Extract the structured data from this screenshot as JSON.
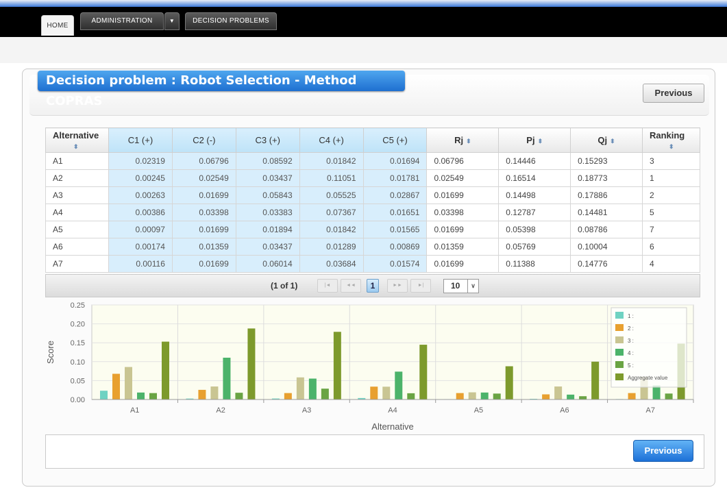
{
  "nav": {
    "home": "HOME",
    "administration": "ADMINISTRATION",
    "admin_arrow": "▼",
    "decision_problems": "DECISION PROBLEMS"
  },
  "page": {
    "title": "Decision problem : Robot Selection - Method COPRAS",
    "previous_top": "Previous",
    "previous_bottom": "Previous"
  },
  "table": {
    "headers": [
      "Alternative",
      "C1 (+)",
      "C2 (-)",
      "C3 (+)",
      "C4 (+)",
      "C5 (+)",
      "Rj",
      "Pj",
      "Qj",
      "Ranking"
    ],
    "rows": [
      [
        "A1",
        "0.02319",
        "0.06796",
        "0.08592",
        "0.01842",
        "0.01694",
        "0.06796",
        "0.14446",
        "0.15293",
        "3"
      ],
      [
        "A2",
        "0.00245",
        "0.02549",
        "0.03437",
        "0.11051",
        "0.01781",
        "0.02549",
        "0.16514",
        "0.18773",
        "1"
      ],
      [
        "A3",
        "0.00263",
        "0.01699",
        "0.05843",
        "0.05525",
        "0.02867",
        "0.01699",
        "0.14498",
        "0.17886",
        "2"
      ],
      [
        "A4",
        "0.00386",
        "0.03398",
        "0.03383",
        "0.07367",
        "0.01651",
        "0.03398",
        "0.12787",
        "0.14481",
        "5"
      ],
      [
        "A5",
        "0.00097",
        "0.01699",
        "0.01894",
        "0.01842",
        "0.01565",
        "0.01699",
        "0.05398",
        "0.08786",
        "7"
      ],
      [
        "A6",
        "0.00174",
        "0.01359",
        "0.03437",
        "0.01289",
        "0.00869",
        "0.01359",
        "0.05769",
        "0.10004",
        "6"
      ],
      [
        "A7",
        "0.00116",
        "0.01699",
        "0.06014",
        "0.03684",
        "0.01574",
        "0.01699",
        "0.11388",
        "0.14776",
        "4"
      ]
    ]
  },
  "pager": {
    "summary": "(1 of 1)",
    "first": "|◄",
    "prev": "◄◄",
    "page": "1",
    "next": "►►",
    "last": "►|",
    "rows_per_page": "10",
    "rows_arrow": "∨"
  },
  "colors": {
    "c1": "#6fd2c2",
    "c2": "#e8a02f",
    "c3": "#c9c592",
    "c4": "#4cb36a",
    "c5": "#6aa443",
    "agg": "#7d9a2c"
  },
  "chart_data": {
    "type": "bar",
    "categories": [
      "A1",
      "A2",
      "A3",
      "A4",
      "A5",
      "A6",
      "A7"
    ],
    "series": [
      {
        "name": "1 :",
        "values": [
          0.02319,
          0.00245,
          0.00263,
          0.00386,
          0.00097,
          0.00174,
          0.00116
        ]
      },
      {
        "name": "2 :",
        "values": [
          0.06796,
          0.02549,
          0.01699,
          0.03398,
          0.01699,
          0.01359,
          0.01699
        ]
      },
      {
        "name": "3 :",
        "values": [
          0.08592,
          0.03437,
          0.05843,
          0.03383,
          0.01894,
          0.03437,
          0.06014
        ]
      },
      {
        "name": "4 :",
        "values": [
          0.01842,
          0.11051,
          0.05525,
          0.07367,
          0.01842,
          0.01289,
          0.03684
        ]
      },
      {
        "name": "5 :",
        "values": [
          0.01694,
          0.01781,
          0.02867,
          0.01651,
          0.01565,
          0.00869,
          0.01574
        ]
      },
      {
        "name": "Aggregate value",
        "values": [
          0.15293,
          0.18773,
          0.17886,
          0.14481,
          0.08786,
          0.10004,
          0.14776
        ]
      }
    ],
    "xlabel": "Alternative",
    "ylabel": "Score",
    "ylim": [
      0,
      0.25
    ],
    "yticks": [
      "0.00",
      "0.05",
      "0.10",
      "0.15",
      "0.20",
      "0.25"
    ],
    "legend_position": "top-right"
  }
}
